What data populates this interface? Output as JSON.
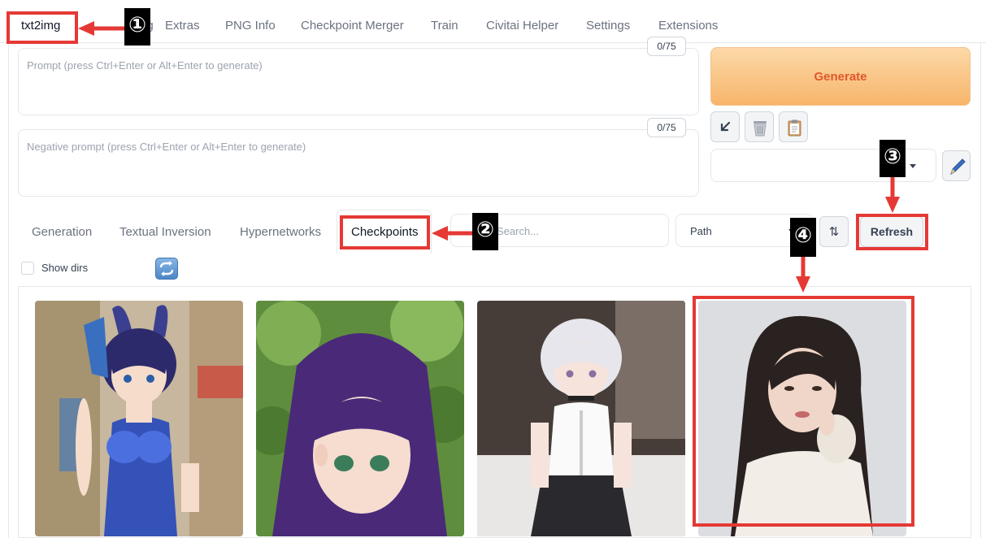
{
  "top_tabs": [
    {
      "label": "txt2img"
    },
    {
      "label": "img2img"
    },
    {
      "label": "Extras"
    },
    {
      "label": "PNG Info"
    },
    {
      "label": "Checkpoint Merger"
    },
    {
      "label": "Train"
    },
    {
      "label": "Civitai Helper"
    },
    {
      "label": "Settings"
    },
    {
      "label": "Extensions"
    }
  ],
  "prompt": {
    "placeholder": "Prompt (press Ctrl+Enter or Alt+Enter to generate)",
    "counter": "0/75"
  },
  "negative_prompt": {
    "placeholder": "Negative prompt (press Ctrl+Enter or Alt+Enter to generate)",
    "counter": "0/75"
  },
  "generate_label": "Generate",
  "tools": [
    {
      "icon": "arrow-down-left-icon"
    },
    {
      "icon": "trash-icon"
    },
    {
      "icon": "clipboard-icon"
    }
  ],
  "style_select_value": "",
  "sub_tabs": [
    {
      "label": "Generation"
    },
    {
      "label": "Textual Inversion"
    },
    {
      "label": "Hypernetworks"
    },
    {
      "label": "Checkpoints"
    }
  ],
  "search_placeholder": "Search...",
  "sort_select_value": "Path",
  "sort_icon": "⇅",
  "refresh_label": "Refresh",
  "show_dirs_label": "Show dirs",
  "annotations": {
    "badge1": "①",
    "badge2": "②",
    "badge3": "③",
    "badge4": "④"
  },
  "colors": {
    "annotation_red": "#e53935",
    "generate_text": "#e0582b",
    "generate_bg": "#f7b56a"
  }
}
